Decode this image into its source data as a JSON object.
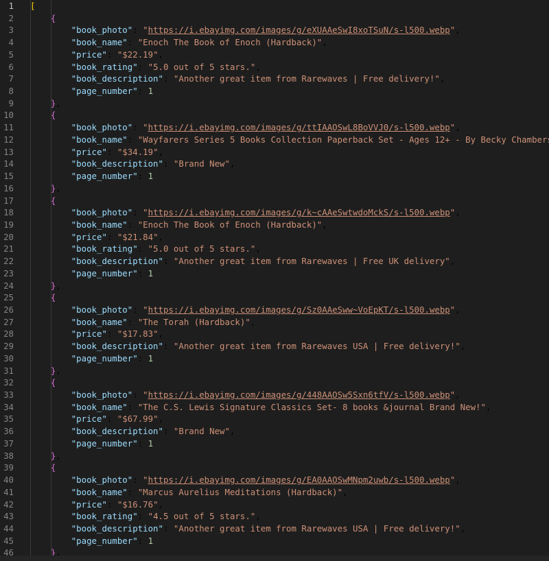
{
  "editor": {
    "lines": [
      {
        "n": "1",
        "active": true,
        "kind": "open-array",
        "bracket": "["
      },
      {
        "n": "2",
        "kind": "open-obj",
        "bracket": "{"
      },
      {
        "n": "3",
        "kind": "prop",
        "key": "book_photo",
        "value": "https://i.ebayimg.com/images/g/eXUAAeSwI8xoTSuN/s-l500.webp",
        "comma": true,
        "link": true
      },
      {
        "n": "4",
        "kind": "prop",
        "key": "book_name",
        "value": "Enoch The Book of Enoch (Hardback)",
        "comma": true
      },
      {
        "n": "5",
        "kind": "prop",
        "key": "price",
        "value": "$22.19",
        "comma": true
      },
      {
        "n": "6",
        "kind": "prop",
        "key": "book_rating",
        "value": "5.0 out of 5 stars.",
        "comma": true
      },
      {
        "n": "7",
        "kind": "prop",
        "key": "book_description",
        "value": "Another great item from Rarewaves | Free delivery!",
        "comma": true
      },
      {
        "n": "8",
        "kind": "num",
        "key": "page_number",
        "value": "1"
      },
      {
        "n": "9",
        "kind": "close-obj",
        "bracket": "}",
        "comma": true
      },
      {
        "n": "10",
        "kind": "open-obj",
        "bracket": "{"
      },
      {
        "n": "11",
        "kind": "prop",
        "key": "book_photo",
        "value": "https://i.ebayimg.com/images/g/ttIAAOSwL8BoVVJ0/s-l500.webp",
        "comma": true,
        "link": true
      },
      {
        "n": "12",
        "kind": "prop",
        "key": "book_name",
        "value": "Wayfarers Series 5 Books Collection Paperback Set - Ages 12+ - By Becky Chambers",
        "comma": true
      },
      {
        "n": "13",
        "kind": "prop",
        "key": "price",
        "value": "$34.19",
        "comma": true
      },
      {
        "n": "14",
        "kind": "prop",
        "key": "book_description",
        "value": "Brand New",
        "comma": true
      },
      {
        "n": "15",
        "kind": "num",
        "key": "page_number",
        "value": "1"
      },
      {
        "n": "16",
        "kind": "close-obj",
        "bracket": "}",
        "comma": true
      },
      {
        "n": "17",
        "kind": "open-obj",
        "bracket": "{"
      },
      {
        "n": "18",
        "kind": "prop",
        "key": "book_photo",
        "value": "https://i.ebayimg.com/images/g/k~cAAeSwtwdoMckS/s-l500.webp",
        "comma": true,
        "link": true
      },
      {
        "n": "19",
        "kind": "prop",
        "key": "book_name",
        "value": "Enoch The Book of Enoch (Hardback)",
        "comma": true
      },
      {
        "n": "20",
        "kind": "prop",
        "key": "price",
        "value": "$21.84",
        "comma": true
      },
      {
        "n": "21",
        "kind": "prop",
        "key": "book_rating",
        "value": "5.0 out of 5 stars.",
        "comma": true
      },
      {
        "n": "22",
        "kind": "prop",
        "key": "book_description",
        "value": "Another great item from Rarewaves | Free UK delivery",
        "comma": true
      },
      {
        "n": "23",
        "kind": "num",
        "key": "page_number",
        "value": "1"
      },
      {
        "n": "24",
        "kind": "close-obj",
        "bracket": "}",
        "comma": true
      },
      {
        "n": "25",
        "kind": "open-obj",
        "bracket": "{"
      },
      {
        "n": "26",
        "kind": "prop",
        "key": "book_photo",
        "value": "https://i.ebayimg.com/images/g/Sz0AAeSww~VoEpKT/s-l500.webp",
        "comma": true,
        "link": true
      },
      {
        "n": "27",
        "kind": "prop",
        "key": "book_name",
        "value": "The Torah (Hardback)",
        "comma": true
      },
      {
        "n": "28",
        "kind": "prop",
        "key": "price",
        "value": "$17.83",
        "comma": true
      },
      {
        "n": "29",
        "kind": "prop",
        "key": "book_description",
        "value": "Another great item from Rarewaves USA | Free delivery!",
        "comma": true
      },
      {
        "n": "30",
        "kind": "num",
        "key": "page_number",
        "value": "1"
      },
      {
        "n": "31",
        "kind": "close-obj",
        "bracket": "}",
        "comma": true
      },
      {
        "n": "32",
        "kind": "open-obj",
        "bracket": "{"
      },
      {
        "n": "33",
        "kind": "prop",
        "key": "book_photo",
        "value": "https://i.ebayimg.com/images/g/448AAOSw5Sxn6tfV/s-l500.webp",
        "comma": true,
        "link": true
      },
      {
        "n": "34",
        "kind": "prop",
        "key": "book_name",
        "value": "The C.S. Lewis Signature Classics Set- 8 books &journal Brand New!",
        "comma": true
      },
      {
        "n": "35",
        "kind": "prop",
        "key": "price",
        "value": "$67.99",
        "comma": true
      },
      {
        "n": "36",
        "kind": "prop",
        "key": "book_description",
        "value": "Brand New",
        "comma": true
      },
      {
        "n": "37",
        "kind": "num",
        "key": "page_number",
        "value": "1"
      },
      {
        "n": "38",
        "kind": "close-obj",
        "bracket": "}",
        "comma": true
      },
      {
        "n": "39",
        "kind": "open-obj",
        "bracket": "{"
      },
      {
        "n": "40",
        "kind": "prop",
        "key": "book_photo",
        "value": "https://i.ebayimg.com/images/g/EA0AAOSwMNpm2uwb/s-l500.webp",
        "comma": true,
        "link": true
      },
      {
        "n": "41",
        "kind": "prop",
        "key": "book_name",
        "value": "Marcus Aurelius Meditations (Hardback)",
        "comma": true
      },
      {
        "n": "42",
        "kind": "prop",
        "key": "price",
        "value": "$16.76",
        "comma": true
      },
      {
        "n": "43",
        "kind": "prop",
        "key": "book_rating",
        "value": "4.5 out of 5 stars.",
        "comma": true
      },
      {
        "n": "44",
        "kind": "prop",
        "key": "book_description",
        "value": "Another great item from Rarewaves USA | Free delivery!",
        "comma": true
      },
      {
        "n": "45",
        "kind": "num",
        "key": "page_number",
        "value": "1"
      },
      {
        "n": "46",
        "kind": "close-obj",
        "bracket": "}",
        "comma": true
      }
    ]
  },
  "colors": {
    "background": "#1e1e1e",
    "key": "#9cdcfe",
    "string": "#ce9178",
    "number": "#b5cea8",
    "bracket_level1": "#ffd700",
    "bracket_level2": "#da70d6"
  }
}
